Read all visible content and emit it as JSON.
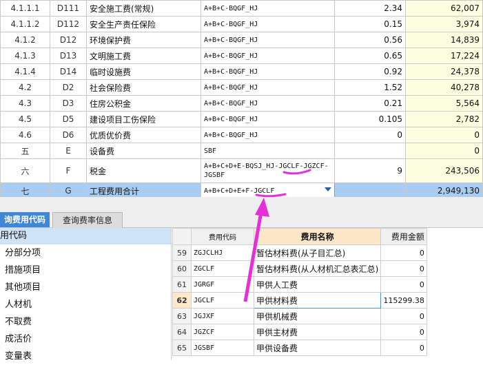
{
  "fee_rows": [
    {
      "seq": "4.1.1.1",
      "code": "D111",
      "name": "安全施工费(常规)",
      "formula": "A+B+C-BQGF_HJ",
      "rate": "2.34",
      "amount": "62,007"
    },
    {
      "seq": "4.1.1.2",
      "code": "D112",
      "name": "安全生产责任保险",
      "formula": "A+B+C-BQGF_HJ",
      "rate": "0.15",
      "amount": "3,974"
    },
    {
      "seq": "4.1.2",
      "code": "D12",
      "name": "环境保护费",
      "formula": "A+B+C-BQGF_HJ",
      "rate": "0.56",
      "amount": "14,839"
    },
    {
      "seq": "4.1.3",
      "code": "D13",
      "name": "文明施工费",
      "formula": "A+B+C-BQGF_HJ",
      "rate": "0.65",
      "amount": "17,224"
    },
    {
      "seq": "4.1.4",
      "code": "D14",
      "name": "临时设施费",
      "formula": "A+B+C-BQGF_HJ",
      "rate": "0.92",
      "amount": "24,378"
    },
    {
      "seq": "4.2",
      "code": "D2",
      "name": "社会保险费",
      "formula": "A+B+C-BQGF_HJ",
      "rate": "1.52",
      "amount": "40,278"
    },
    {
      "seq": "4.3",
      "code": "D3",
      "name": "住房公积金",
      "formula": "A+B+C-BQGF_HJ",
      "rate": "0.21",
      "amount": "5,564"
    },
    {
      "seq": "4.5",
      "code": "D5",
      "name": "建设项目工伤保险",
      "formula": "A+B+C-BQGF_HJ",
      "rate": "0.105",
      "amount": "2,782"
    },
    {
      "seq": "4.6",
      "code": "D6",
      "name": "优质优价费",
      "formula": "A+B+C-BQGF_HJ",
      "rate": "0",
      "amount": "0"
    },
    {
      "seq": "五",
      "code": "E",
      "name": "设备费",
      "formula": "SBF",
      "rate": "",
      "amount": "0"
    }
  ],
  "tax_row": {
    "seq": "六",
    "code": "F",
    "name": "税金",
    "formula": "A+B+C+D+E-BQSJ_HJ-JGCLF-JGZCF-JGSBF",
    "rate": "9",
    "amount": "243,506"
  },
  "total_row": {
    "seq": "七",
    "code": "G",
    "name": "工程费用合计",
    "formula": "A+B+C+D+E+F-JGCLF",
    "amount": "2,949,130"
  },
  "tabs": {
    "active": "询费用代码",
    "inactive": "查询费率信息"
  },
  "tree": {
    "header": "用代码",
    "items": [
      "分部分项",
      "措施项目",
      "其他项目",
      "人材机",
      "不取费",
      "成活价",
      "变量表"
    ]
  },
  "code_table": {
    "headers": {
      "code": "费用代码",
      "name": "费用名称",
      "amount": "费用金额"
    },
    "rows": [
      {
        "n": "59",
        "code": "ZGJCLHJ",
        "name": "暂估材料费(从子目汇总)",
        "amount": "0"
      },
      {
        "n": "60",
        "code": "ZGCLF",
        "name": "暂估材料费(从人材机汇总表汇总)",
        "amount": "0"
      },
      {
        "n": "61",
        "code": "JGRGF",
        "name": "甲供人工费",
        "amount": "0"
      },
      {
        "n": "62",
        "code": "JGCLF",
        "name": "甲供材料费",
        "amount": "115299.38"
      },
      {
        "n": "63",
        "code": "JGJXF",
        "name": "甲供机械费",
        "amount": "0"
      },
      {
        "n": "64",
        "code": "JGZCF",
        "name": "甲供主材费",
        "amount": "0"
      },
      {
        "n": "65",
        "code": "JGSBF",
        "name": "甲供设备费",
        "amount": "0"
      }
    ]
  },
  "colors": {
    "selected_row": "#a9cdf2",
    "amount_bg": "#fdfde0",
    "active_tab": "#3e86d6",
    "annotation": "#e62fd8"
  }
}
